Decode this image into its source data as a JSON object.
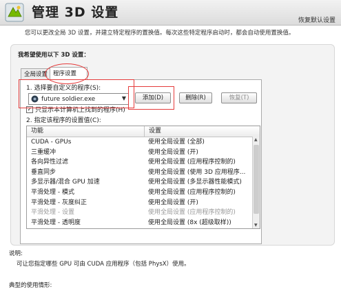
{
  "header": {
    "title": "管理 3D 设置",
    "restore_defaults": "恢复默认设置",
    "icon": "nvidia-3d-settings-icon"
  },
  "description": "您可以更改全局 3D 设置，并建立特定程序的置换值。每次这些特定程序启动时，都会自动使用置换值。",
  "settings": {
    "heading": "我希望使用以下 3D 设置：",
    "tabs": [
      {
        "label": "全局设置",
        "selected": false
      },
      {
        "label": "程序设置",
        "selected": true
      }
    ],
    "step1_label": "1. 选择要自定义的程序(S):",
    "program_selected": "future soldier.exe",
    "buttons": {
      "add": "添加(D)",
      "delete": "删除(R)",
      "restore": "恢复(T)"
    },
    "checkbox_label": "只显示本计算机上找到的程序(H)",
    "checkbox_checked": true,
    "step2_label": "2. 指定该程序的设置值(C):",
    "table": {
      "headers": [
        "功能",
        "设置"
      ],
      "rows": [
        {
          "feature": "CUDA - GPUs",
          "setting": "使用全局设置 (全部)",
          "disabled": false
        },
        {
          "feature": "三重缓冲",
          "setting": "使用全局设置 (开)",
          "disabled": false
        },
        {
          "feature": "各向异性过滤",
          "setting": "使用全局设置 (应用程序控制的)",
          "disabled": false
        },
        {
          "feature": "垂直同步",
          "setting": "使用全局设置 (使用 3D 应用程序...",
          "disabled": false
        },
        {
          "feature": "多显示器/混合 GPU 加速",
          "setting": "使用全局设置 (多显示器性能模式)",
          "disabled": false
        },
        {
          "feature": "平滑处理 - 模式",
          "setting": "使用全局设置 (应用程序控制的)",
          "disabled": false
        },
        {
          "feature": "平滑处理 - 灰度纠正",
          "setting": "使用全局设置 (开)",
          "disabled": false
        },
        {
          "feature": "平滑处理 - 设置",
          "setting": "使用全局设置 (应用程序控制的)",
          "disabled": true
        },
        {
          "feature": "平滑处理 - 透明度",
          "setting": "使用全局设置 (8x (超级取样))",
          "disabled": false
        }
      ]
    }
  },
  "explain": {
    "heading": "说明:",
    "text": "可让您指定哪些 GPU 可由 CUDA 应用程序（包括 PhysX）使用。"
  },
  "usage_heading": "典型的使用情形:",
  "colors": {
    "highlight_red": "#e53b3b",
    "nvidia_green": "#76b900"
  }
}
